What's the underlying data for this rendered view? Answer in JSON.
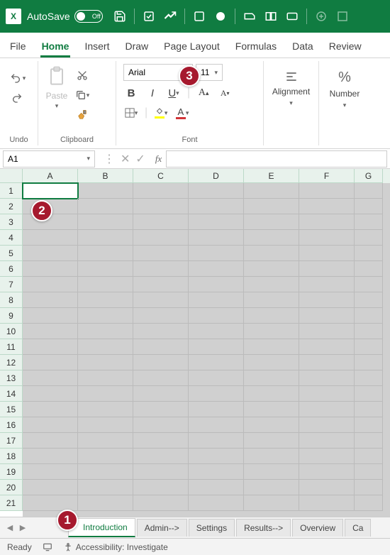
{
  "titlebar": {
    "app_icon_text": "X",
    "autosave_label": "AutoSave",
    "autosave_state": "Off"
  },
  "tabs": {
    "file": "File",
    "home": "Home",
    "insert": "Insert",
    "draw": "Draw",
    "page_layout": "Page Layout",
    "formulas": "Formulas",
    "data": "Data",
    "review": "Review",
    "active": "Home"
  },
  "ribbon": {
    "undo_group": "Undo",
    "clipboard_group": "Clipboard",
    "paste_label": "Paste",
    "font_group": "Font",
    "font_name": "Arial",
    "font_size": "11",
    "alignment_label": "Alignment",
    "number_label": "Number"
  },
  "namebox": {
    "cell_ref": "A1",
    "fx_label": "fx"
  },
  "grid": {
    "columns": [
      "A",
      "B",
      "C",
      "D",
      "E",
      "F",
      "G"
    ],
    "rows": [
      "1",
      "2",
      "3",
      "4",
      "5",
      "6",
      "7",
      "8",
      "9",
      "10",
      "11",
      "12",
      "13",
      "14",
      "15",
      "16",
      "17",
      "18",
      "19",
      "20",
      "21"
    ],
    "active_cell": "A1"
  },
  "sheets": {
    "tabs": [
      "Introduction",
      "Admin-->",
      "Settings",
      "Results-->",
      "Overview",
      "Ca"
    ],
    "active": "Introduction"
  },
  "statusbar": {
    "ready": "Ready",
    "accessibility": "Accessibility: Investigate"
  },
  "callouts": {
    "c1": "1",
    "c2": "2",
    "c3": "3"
  },
  "colors": {
    "brand": "#107c41",
    "callout": "#a6192e",
    "highlight": "#ffff00",
    "fontcolor": "#d13438"
  }
}
